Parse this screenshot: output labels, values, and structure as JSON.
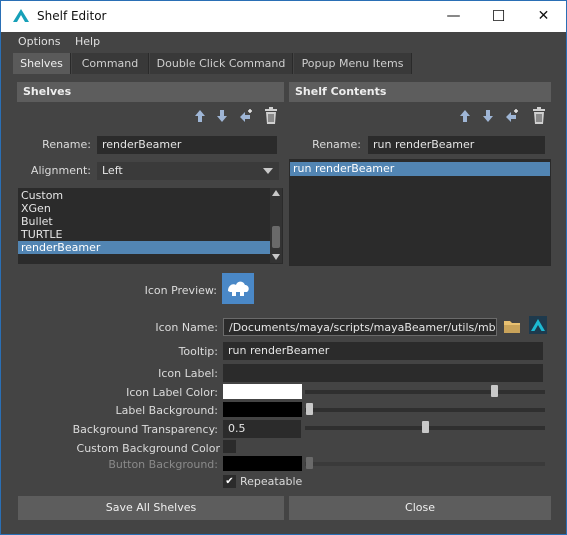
{
  "window": {
    "title": "Shelf Editor",
    "minimize": "—",
    "maximize": "☐",
    "close": "✕"
  },
  "menu": [
    "Options",
    "Help"
  ],
  "tabs": [
    "Shelves",
    "Command",
    "Double Click Command",
    "Popup Menu Items"
  ],
  "shelves": {
    "header": "Shelves",
    "rename_label": "Rename:",
    "rename_value": "renderBeamer",
    "alignment_label": "Alignment:",
    "alignment_value": "Left",
    "items": [
      "Custom",
      "XGen",
      "Bullet",
      "TURTLE",
      "renderBeamer"
    ],
    "selected_index": 4
  },
  "shelf_contents": {
    "header": "Shelf Contents",
    "rename_label": "Rename:",
    "rename_value": "run renderBeamer",
    "items": [
      "run renderBeamer"
    ],
    "selected_index": 0
  },
  "icon_preview_label": "Icon Preview:",
  "form": {
    "icon_name_label": "Icon Name:",
    "icon_name_value": "/Documents/maya/scripts/mayaBeamer/utils/mb.xpm",
    "tooltip_label": "Tooltip:",
    "tooltip_value": "run renderBeamer",
    "icon_label_label": "Icon Label:",
    "icon_label_value": "",
    "icon_label_color_label": "Icon Label Color:",
    "label_background_label": "Label Background:",
    "background_transparency_label": "Background Transparency:",
    "background_transparency_value": "0.5",
    "custom_background_color_label": "Custom Background Color",
    "button_background_label": "Button Background:",
    "repeatable_label": "Repeatable",
    "repeatable_checked": true
  },
  "buttons": {
    "save_all": "Save All Shelves",
    "close": "Close"
  },
  "colors": {
    "accent": "#5285b3",
    "icon_label_color": "#ffffff",
    "label_background": "#000000",
    "button_background": "#000000"
  }
}
